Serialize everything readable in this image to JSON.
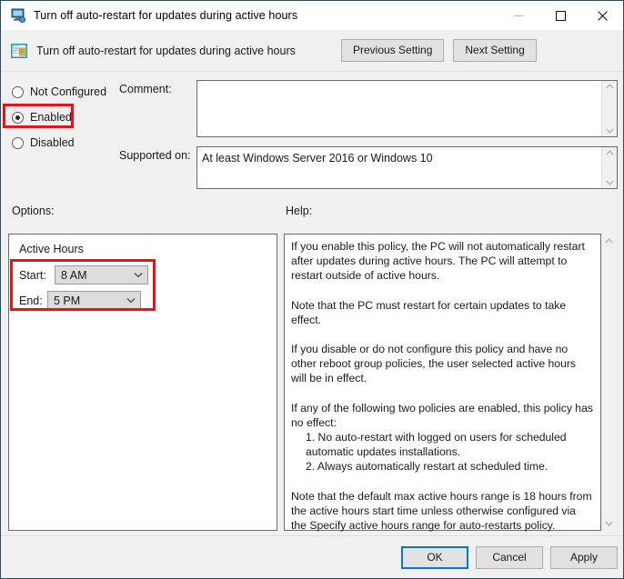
{
  "window": {
    "title": "Turn off auto-restart for updates during active hours",
    "title_icon": "computer-monitor-icon",
    "minimize_label": "—",
    "maximize_label": "☐",
    "close_label": "✕"
  },
  "header": {
    "icon": "group-policy-setting-icon",
    "title": "Turn off auto-restart for updates during active hours",
    "previous_setting_label": "Previous Setting",
    "next_setting_label": "Next Setting"
  },
  "state": {
    "not_configured_label": "Not Configured",
    "enabled_label": "Enabled",
    "disabled_label": "Disabled",
    "selected": "Enabled"
  },
  "comment": {
    "label": "Comment:",
    "value": ""
  },
  "supported_on": {
    "label": "Supported on:",
    "value": "At least Windows Server 2016 or Windows 10"
  },
  "options": {
    "label": "Options:",
    "group_title": "Active Hours",
    "start_label": "Start:",
    "start_value": "8 AM",
    "end_label": "End:",
    "end_value": "5 PM"
  },
  "help": {
    "label": "Help:",
    "paragraphs": [
      "If you enable this policy, the PC will not automatically restart after updates during active hours. The PC will attempt to restart outside of active hours.",
      "Note that the PC must restart for certain updates to take effect.",
      "If you disable or do not configure this policy and have no other reboot group policies, the user selected active hours will be in effect.",
      "If any of the following two policies are enabled, this policy has no effect:",
      "1. No auto-restart with logged on users for scheduled automatic updates installations.",
      "2. Always automatically restart at scheduled time.",
      "Note that the default max active hours range is 18 hours from the active hours start time unless otherwise configured via the Specify active hours range for auto-restarts policy."
    ]
  },
  "footer": {
    "ok_label": "OK",
    "cancel_label": "Cancel",
    "apply_label": "Apply"
  },
  "annotations": {
    "accent_color": "#ee1111",
    "highlighted": [
      "Enabled radio option",
      "Active Hours start and end dropdowns"
    ]
  }
}
